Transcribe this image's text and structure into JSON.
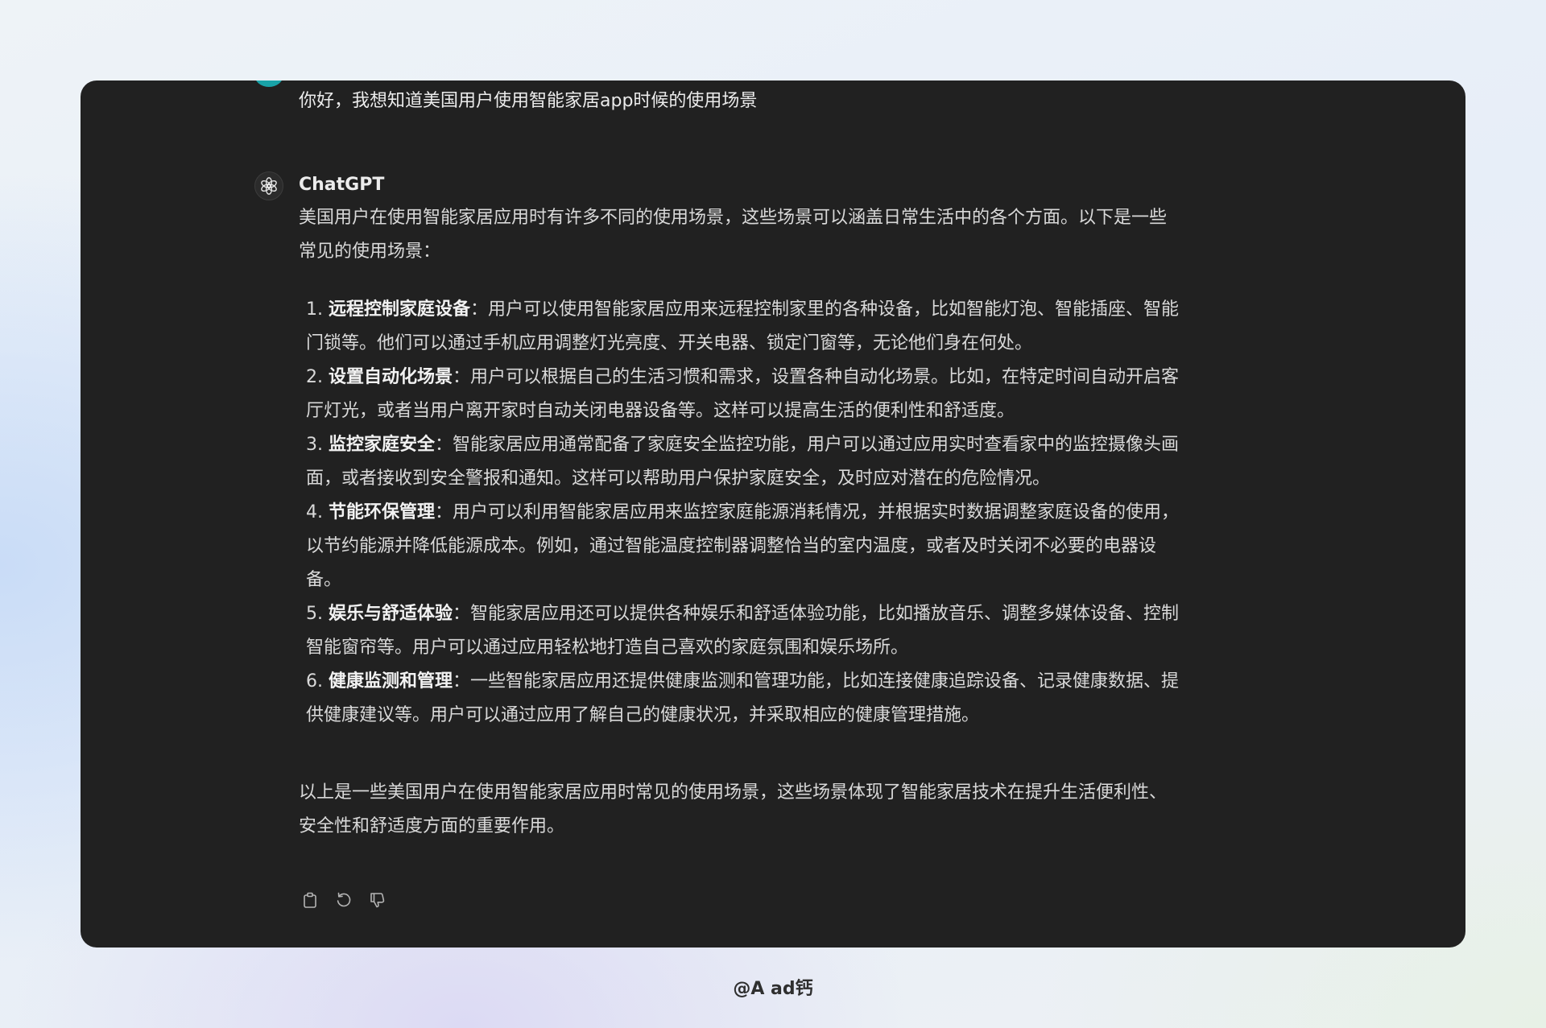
{
  "conversation": {
    "user_message": "你好，我想知道美国用户使用智能家居app时候的使用场景",
    "assistant_name": "ChatGPT",
    "intro": "美国用户在使用智能家居应用时有许多不同的使用场景，这些场景可以涵盖日常生活中的各个方面。以下是一些常见的使用场景：",
    "items": [
      {
        "num": "1.",
        "title": "远程控制家庭设备",
        "text": "：用户可以使用智能家居应用来远程控制家里的各种设备，比如智能灯泡、智能插座、智能门锁等。他们可以通过手机应用调整灯光亮度、开关电器、锁定门窗等，无论他们身在何处。"
      },
      {
        "num": "2.",
        "title": "设置自动化场景",
        "text": "：用户可以根据自己的生活习惯和需求，设置各种自动化场景。比如，在特定时间自动开启客厅灯光，或者当用户离开家时自动关闭电器设备等。这样可以提高生活的便利性和舒适度。"
      },
      {
        "num": "3.",
        "title": "监控家庭安全",
        "text": "：智能家居应用通常配备了家庭安全监控功能，用户可以通过应用实时查看家中的监控摄像头画面，或者接收到安全警报和通知。这样可以帮助用户保护家庭安全，及时应对潜在的危险情况。"
      },
      {
        "num": "4.",
        "title": "节能环保管理",
        "text": "：用户可以利用智能家居应用来监控家庭能源消耗情况，并根据实时数据调整家庭设备的使用，以节约能源并降低能源成本。例如，通过智能温度控制器调整恰当的室内温度，或者及时关闭不必要的电器设备。"
      },
      {
        "num": "5.",
        "title": "娱乐与舒适体验",
        "text": "：智能家居应用还可以提供各种娱乐和舒适体验功能，比如播放音乐、调整多媒体设备、控制智能窗帘等。用户可以通过应用轻松地打造自己喜欢的家庭氛围和娱乐场所。"
      },
      {
        "num": "6.",
        "title": "健康监测和管理",
        "text": "：一些智能家居应用还提供健康监测和管理功能，比如连接健康追踪设备、记录健康数据、提供健康建议等。用户可以通过应用了解自己的健康状况，并采取相应的健康管理措施。"
      }
    ],
    "conclusion": "以上是一些美国用户在使用智能家居应用时常见的使用场景，这些场景体现了智能家居技术在提升生活便利性、安全性和舒适度方面的重要作用。",
    "actions": [
      {
        "icon": "copy-icon"
      },
      {
        "icon": "regenerate-icon"
      },
      {
        "icon": "thumbs-down-icon"
      }
    ]
  },
  "watermark": "@A ad钙",
  "colors": {
    "card_background": "#212121",
    "user_avatar": "#19a3a8",
    "text": "#d9d9d9"
  }
}
